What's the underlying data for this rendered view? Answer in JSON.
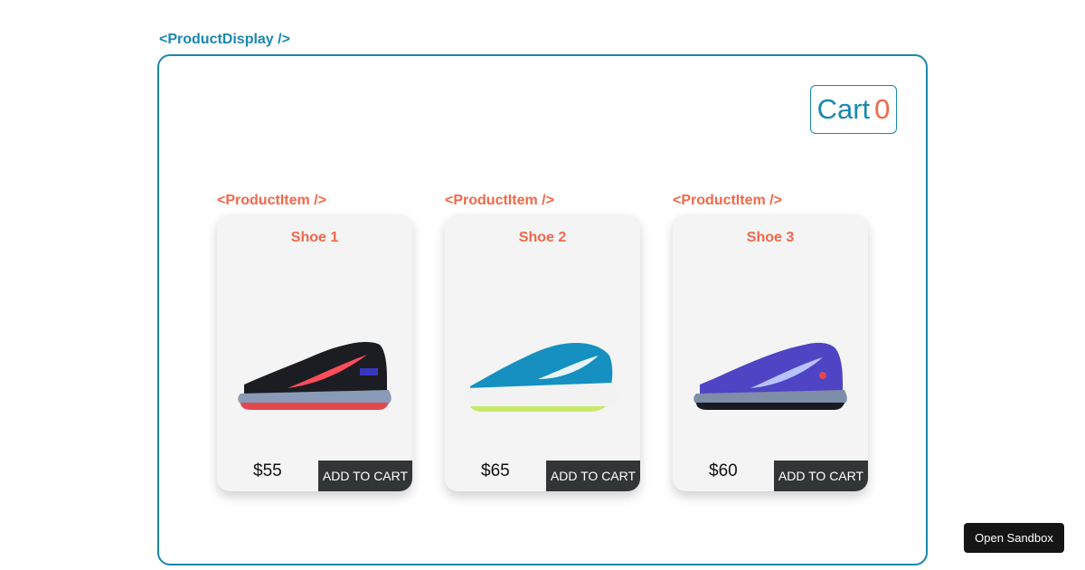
{
  "product_display": {
    "label": "<ProductDisplay />",
    "cart": {
      "label": "Cart",
      "count": "0"
    }
  },
  "products": [
    {
      "component_label": "<ProductItem />",
      "title": "Shoe 1",
      "price": "$55",
      "button_label": "ADD TO CART",
      "image_icon": "black-running-shoe-icon",
      "colors": {
        "upper": "#1c1d22",
        "swoosh": "#ff4d5a",
        "sole": "#8a9bb8",
        "outsole": "#e0484e"
      }
    },
    {
      "component_label": "<ProductItem />",
      "title": "Shoe 2",
      "price": "$65",
      "button_label": "ADD TO CART",
      "image_icon": "teal-running-shoe-icon",
      "colors": {
        "upper": "#1590c0",
        "swoosh": "#e8f4f8",
        "sole": "#f2f2f2",
        "outsole": "#c9e86a"
      }
    },
    {
      "component_label": "<ProductItem />",
      "title": "Shoe 3",
      "price": "$60",
      "button_label": "ADD TO CART",
      "image_icon": "purple-running-shoe-icon",
      "colors": {
        "upper": "#4e44c4",
        "swoosh": "#b8c3ff",
        "sole": "#7e8da8",
        "outsole": "#1a1a22"
      }
    }
  ],
  "sandbox": {
    "button_label": "Open Sandbox"
  }
}
